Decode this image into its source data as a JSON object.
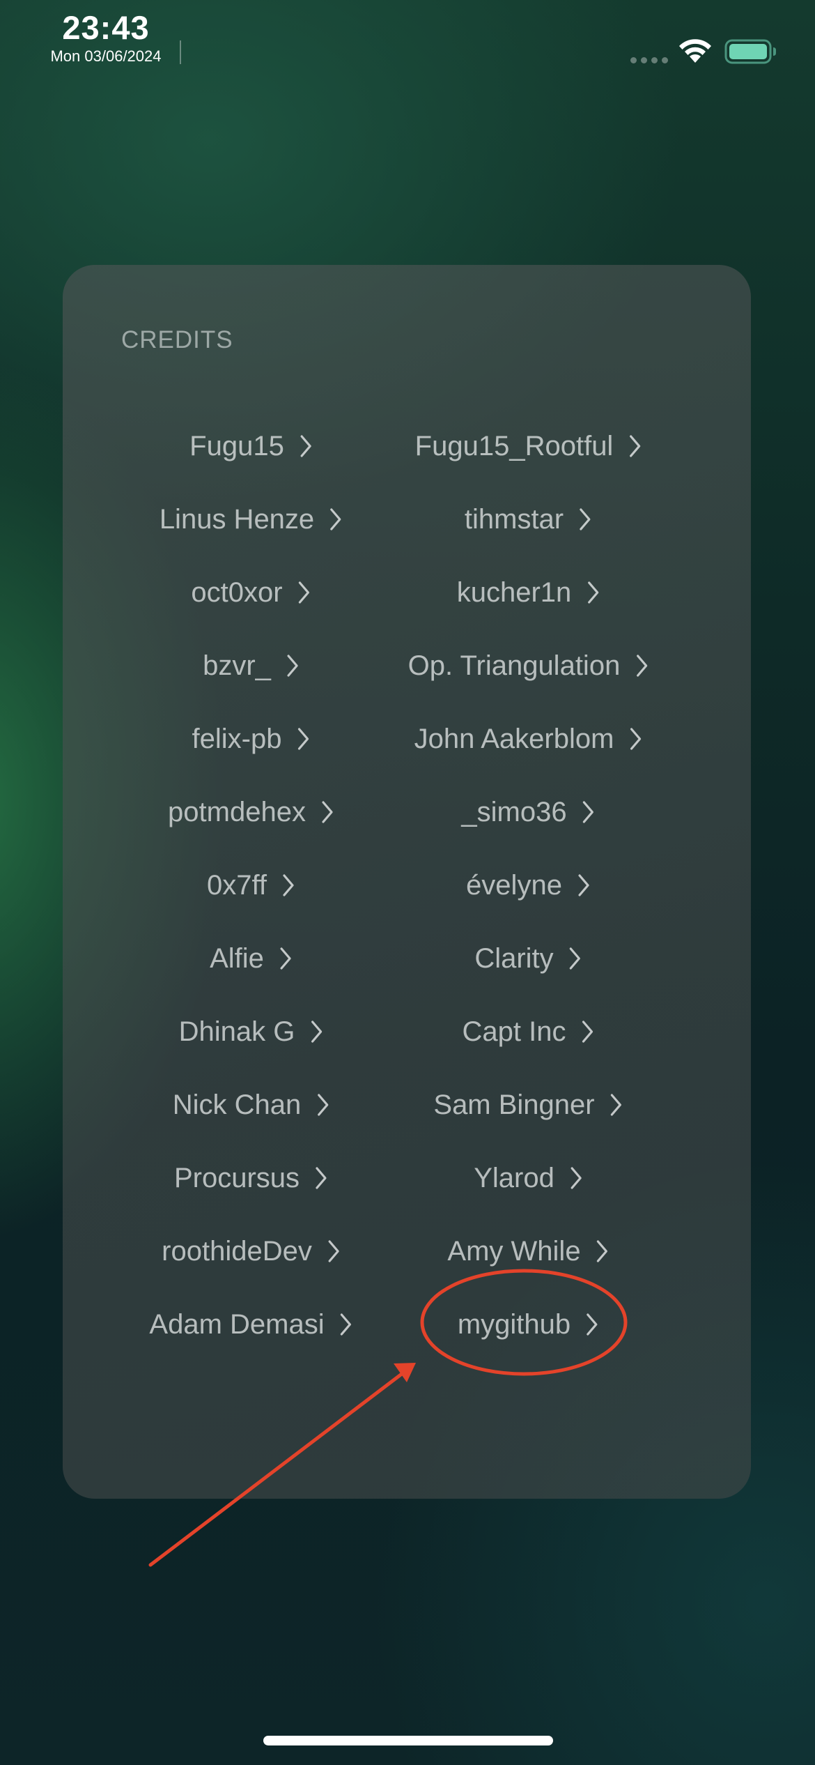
{
  "status_bar": {
    "time": "23:43",
    "date": "Mon 03/06/2024"
  },
  "colors": {
    "accent_annotation": "#e4432a",
    "battery": "#6fd4b4"
  },
  "credits": {
    "title": "CREDITS",
    "left_column": [
      "Fugu15",
      "Linus Henze",
      "oct0xor",
      "bzvr_",
      "felix-pb",
      "potmdehex",
      "0x7ff",
      "Alfie",
      "Dhinak G",
      "Nick Chan",
      "Procursus",
      "roothideDev",
      "Adam Demasi"
    ],
    "right_column": [
      "Fugu15_Rootful",
      "tihmstar",
      "kucher1n",
      "Op. Triangulation",
      "John Aakerblom",
      "_simo36",
      "évelyne",
      "Clarity",
      "Capt Inc",
      "Sam Bingner",
      "Ylarod",
      "Amy While",
      "mygithub"
    ]
  }
}
